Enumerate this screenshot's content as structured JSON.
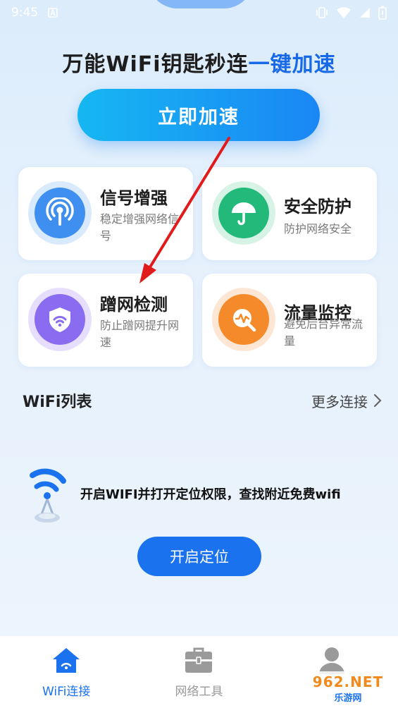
{
  "status_bar": {
    "time": "9:45",
    "icons": [
      "a-notification-icon",
      "vibrate-icon",
      "wifi-icon",
      "signal-icon",
      "battery-icon"
    ]
  },
  "header": {
    "headline_main": "万能WiFi钥匙秒连",
    "headline_accent": "一键加速",
    "boost_button": "立即加速"
  },
  "features": [
    {
      "title": "信号增强",
      "desc": "稳定增强网络信号",
      "icon": "signal-tower-icon",
      "color": "#3f8ff0"
    },
    {
      "title": "安全防护",
      "desc": "防护网络安全",
      "icon": "umbrella-icon",
      "color": "#22b97a"
    },
    {
      "title": "蹭网检测",
      "desc": "防止蹭网提升网速",
      "icon": "shield-wifi-icon",
      "color": "#8a6cf0"
    },
    {
      "title": "流量监控",
      "desc": "避免后台异常流量",
      "icon": "traffic-monitor-icon",
      "color": "#f58a2a"
    }
  ],
  "wifi_section": {
    "title": "WiFi列表",
    "more": "更多连接"
  },
  "wifi_hint": {
    "text": "开启WIFI并打开定位权限，查找附近免费wifi",
    "button": "开启定位"
  },
  "nav": [
    {
      "label": "WiFi连接",
      "icon": "home-wifi-icon",
      "active": true
    },
    {
      "label": "网络工具",
      "icon": "toolbox-icon",
      "active": false
    },
    {
      "label": "",
      "icon": "profile-icon",
      "active": false
    }
  ],
  "watermark": {
    "main": "962.NET",
    "sub": "乐游网"
  },
  "colors": {
    "primary": "#1b72ee",
    "accent_text": "#1869e8",
    "annotation_arrow": "#e11b1b"
  }
}
